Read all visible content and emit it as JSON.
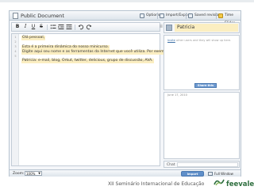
{
  "window": {
    "title": "Public Document",
    "buttons": {
      "options": "Options",
      "import_export": "Import/Export",
      "saved_revisions": "Saved revisions",
      "time_slider": "Time Slider"
    }
  },
  "toolbar": {
    "bold": "B",
    "italic": "I",
    "underline": "U",
    "strike": "S",
    "grip": "⁞⁞"
  },
  "editor": {
    "line_numbers": [
      "1",
      "2",
      "3",
      "4",
      "5"
    ],
    "lines": [
      "Olá pessoal,",
      "Esta é a primeira dinâmica do nosso minicurso.",
      "Digite aqui seu nome e as ferramentas da Internet que você utiliza. Por exemplo:",
      "Patrícia: e-mail, blog, Orkut, twitter, delicious, grupo de discussão, AVA."
    ]
  },
  "sidebar": {
    "user_name": "Patricia",
    "invite_link": "Invite",
    "invite_rest": " other users and they will show up here.",
    "share_button": "Share this",
    "chat_date": "June 17, 2010",
    "chat_label": "Chat"
  },
  "bottombar": {
    "zoom_label": "Zoom:",
    "zoom_value": "100%",
    "import_button": "Import",
    "full_window": "Full Window"
  },
  "footer": {
    "text": "XII Seminário Internacional de Educação",
    "logo": "feevale"
  },
  "colors": {
    "author_highlight": "#fbeec1",
    "link": "#3a6ea5",
    "button_blue": "#5f8fc9",
    "logo_green": "#2f6f3f"
  }
}
